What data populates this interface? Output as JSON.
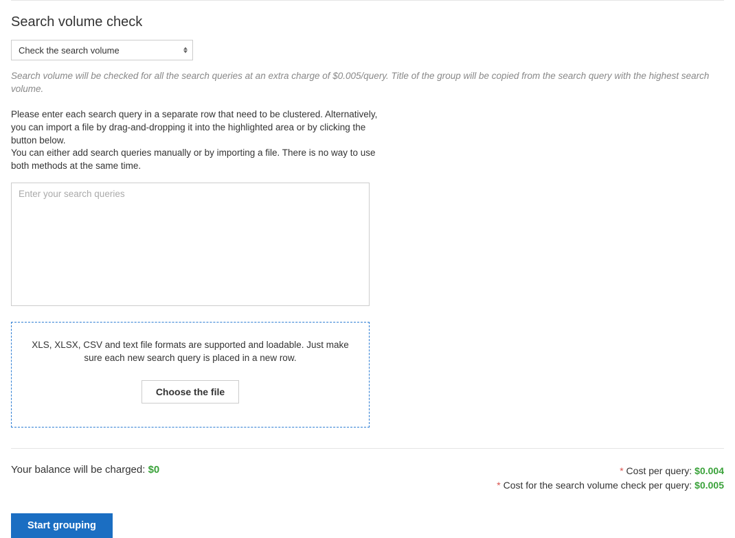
{
  "title": "Search volume check",
  "select": {
    "selected": "Check the search volume"
  },
  "hint": "Search volume will be checked for all the search queries at an extra charge of $0.005/query. Title of the group will be copied from the search query with the highest search volume.",
  "instructions": {
    "p1": "Please enter each search query in a separate row that need to be clustered. Alternatively, you can import a file by drag-and-dropping it into the highlighted area or by clicking the button below.",
    "p2": "You can either add search queries manually or by importing a file. There is no way to use both methods at the same time."
  },
  "textarea": {
    "placeholder": "Enter your search queries"
  },
  "dropzone": {
    "text": "XLS, XLSX, CSV and text file formats are supported and loadable. Just make sure each new search query is placed in a new row.",
    "button": "Choose the file"
  },
  "footer": {
    "balance_label": "Your balance will be charged: ",
    "balance_amount": "$0",
    "cost_query_label": " Cost per query: ",
    "cost_query_amount": "$0.004",
    "cost_volume_label": " Cost for the search volume check per query: ",
    "cost_volume_amount": "$0.005",
    "star": "*"
  },
  "start_button": "Start grouping"
}
